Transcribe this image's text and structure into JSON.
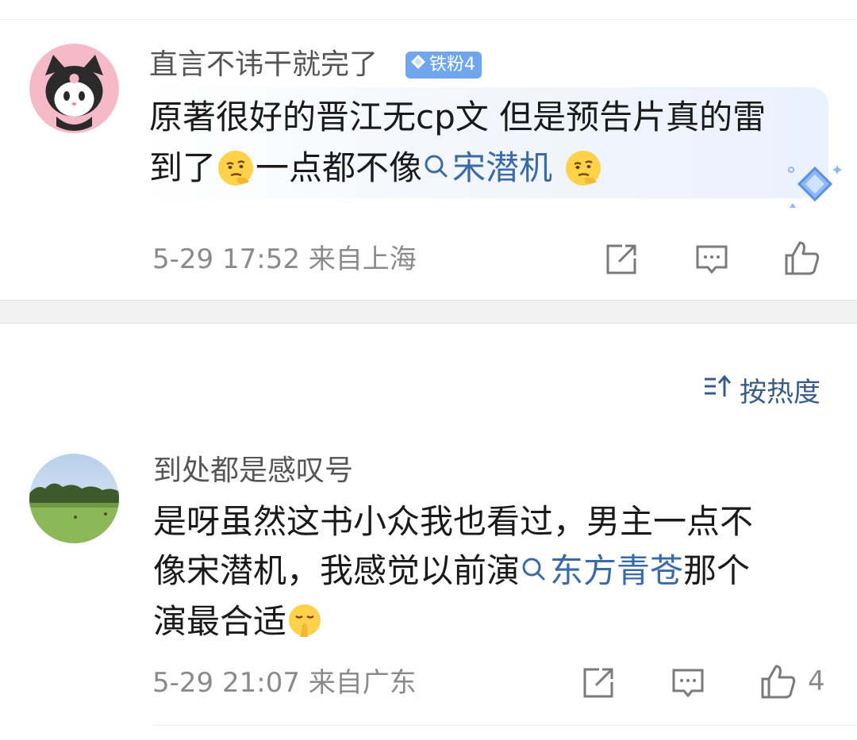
{
  "comments": [
    {
      "username": "直言不讳干就完了",
      "badge": "铁粉4",
      "text_line1": "原著很好的晋江无cp文 但是预告片真的雷",
      "text_line2_prefix": "到了",
      "text_line2_mid": " 一点都不像",
      "topic": "宋潜机",
      "time_location": "5-29 17:52 来自上海",
      "emoji": "thinking-face-icon"
    },
    {
      "username": "到处都是感叹号",
      "text_line1": "是呀虽然这书小众我也看过，男主一点不",
      "text_line2_prefix": "像宋潜机，我感觉以前演",
      "topic": "东方青苍",
      "text_line2_suffix": " 那个",
      "text_line3": "演最合适",
      "time_location": "5-29 21:07 来自广东",
      "like_count": "4",
      "emoji": "shushing-face-icon"
    }
  ],
  "sort": {
    "label": "按热度"
  },
  "colors": {
    "topic": "#3a6aa8",
    "badge": "#6fa6ee",
    "meta": "#8a8a8a"
  }
}
